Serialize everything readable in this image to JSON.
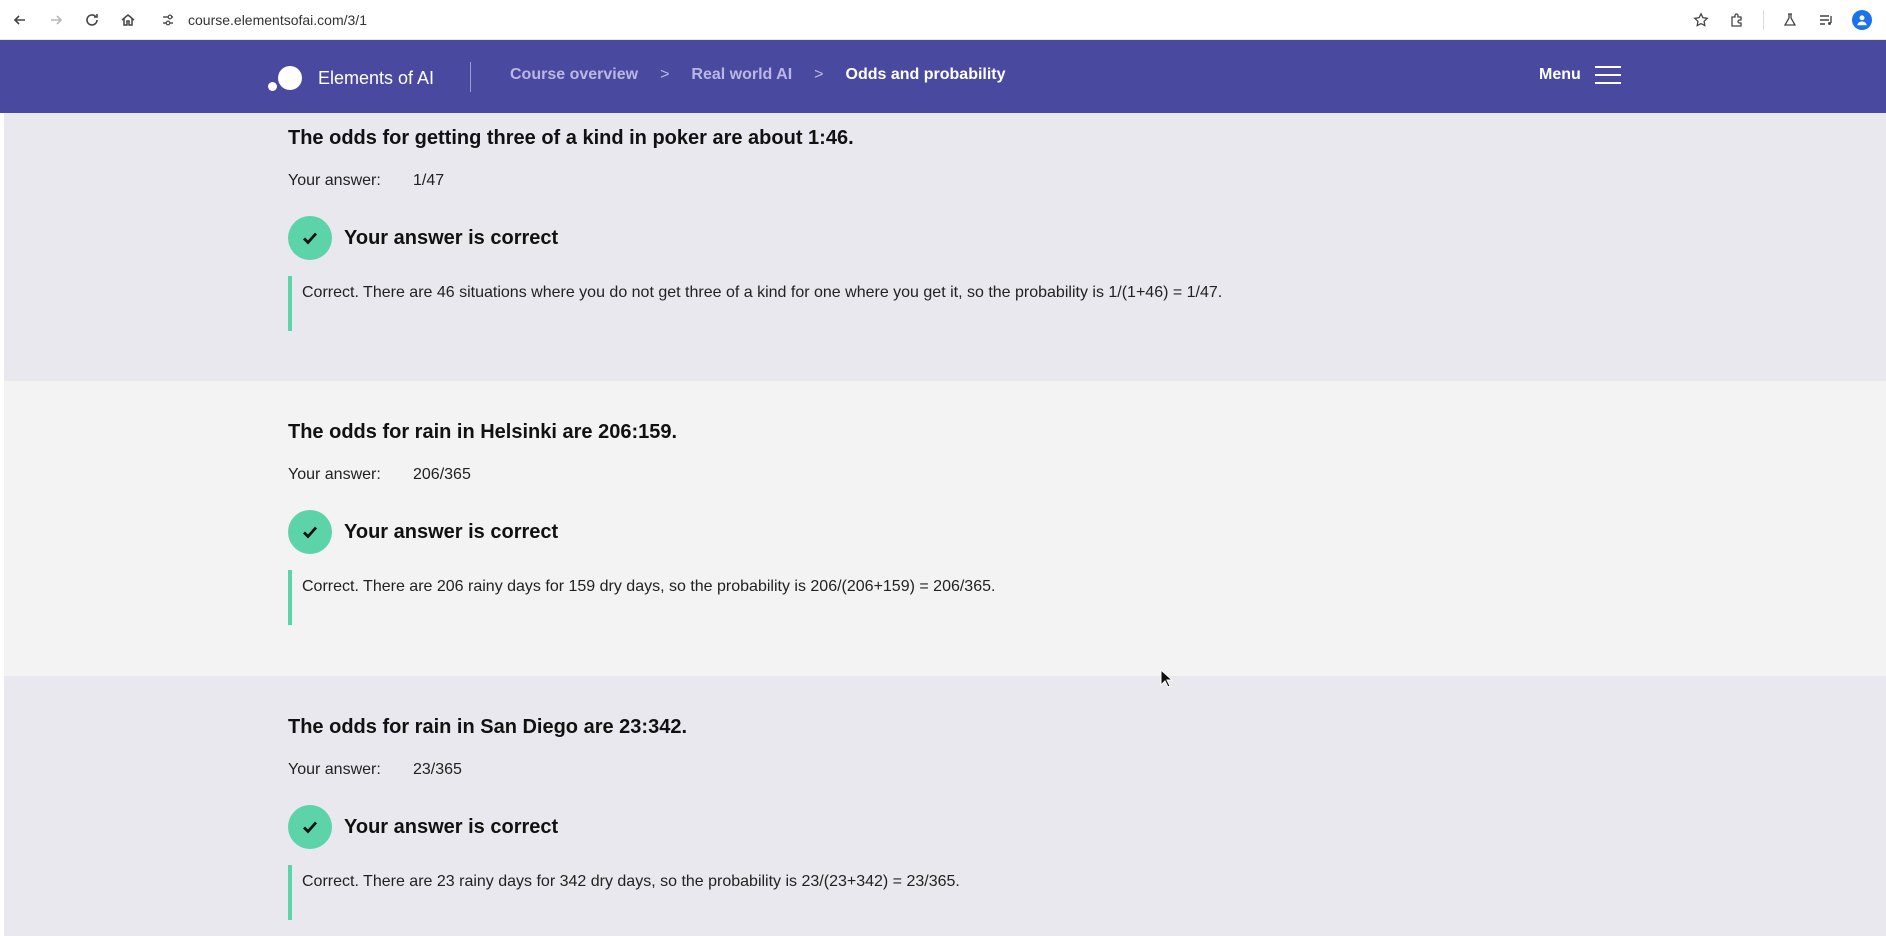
{
  "browser": {
    "url": "course.elementsofai.com/3/1"
  },
  "header": {
    "logo_text": "Elements of AI",
    "breadcrumb": [
      "Course overview",
      "Real world AI",
      "Odds and probability"
    ],
    "menu_label": "Menu"
  },
  "sections": [
    {
      "question": "The odds for getting three of a kind in poker are about 1:46.",
      "answer_label": "Your answer:",
      "answer_value": "1/47",
      "result": "Your answer is correct",
      "explanation": "Correct. There are 46 situations where you do not get three of a kind for one where you get it, so the probability is 1/(1+46) = 1/47."
    },
    {
      "question": "The odds for rain in Helsinki are 206:159.",
      "answer_label": "Your answer:",
      "answer_value": "206/365",
      "result": "Your answer is correct",
      "explanation": "Correct. There are 206 rainy days for 159 dry days, so the probability is 206/(206+159) = 206/365."
    },
    {
      "question": "The odds for rain in San Diego are 23:342.",
      "answer_label": "Your answer:",
      "answer_value": "23/365",
      "result": "Your answer is correct",
      "explanation": "Correct. There are 23 rainy days for 342 dry days, so the probability is 23/(23+342) = 23/365."
    }
  ],
  "colors": {
    "header_bg": "#4a49a0",
    "accent_green": "#5dd3a9",
    "section_dark": "#eae8ef",
    "section_light": "#f4f3f4"
  }
}
